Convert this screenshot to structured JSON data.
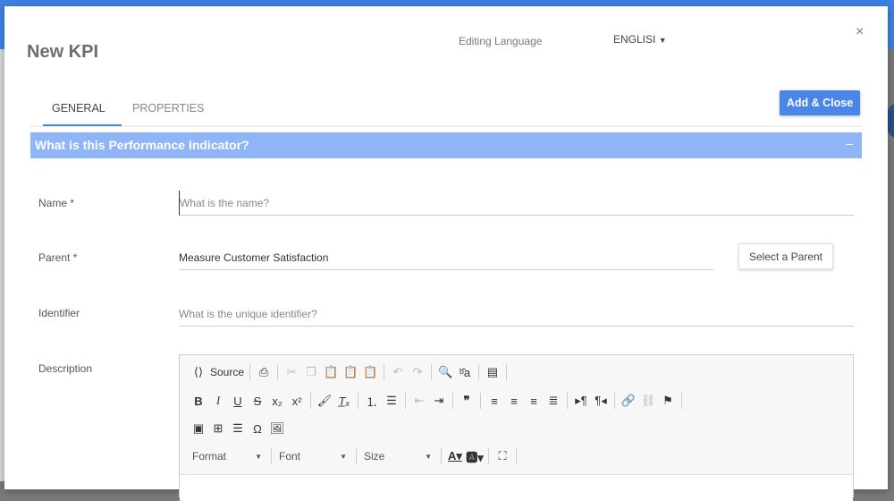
{
  "dialog": {
    "title": "New KPI",
    "editing_language_label": "Editing Language",
    "language": "ENGLISI",
    "close": "×",
    "add_close": "Add & Close"
  },
  "tabs": [
    {
      "label": "GENERAL"
    },
    {
      "label": "PROPERTIES"
    }
  ],
  "section": {
    "title": "What is this Performance Indicator?",
    "collapse": "–"
  },
  "fields": {
    "name": {
      "label": "Name *",
      "placeholder": "What is the name?"
    },
    "parent": {
      "label": "Parent  *",
      "value": "Measure Customer Satisfaction",
      "button": "Select a Parent"
    },
    "identifier": {
      "label": "Identifier",
      "placeholder": "What is the unique identifier?"
    },
    "description": {
      "label": "Description"
    }
  },
  "editor": {
    "source": "Source",
    "format": "Format",
    "font": "Font",
    "size": "Size"
  }
}
